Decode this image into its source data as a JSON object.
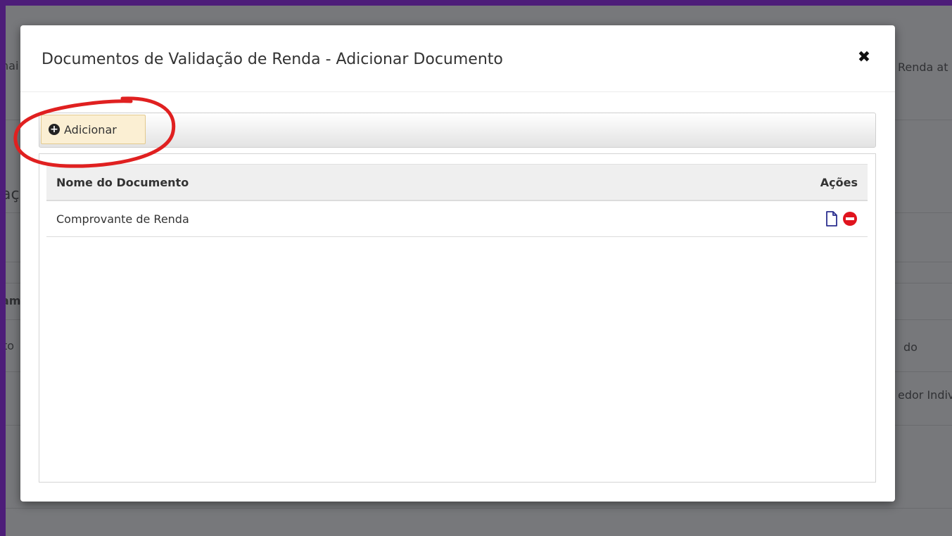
{
  "background": {
    "fragments": [
      "nai",
      "Renda at",
      "aç",
      "am",
      "to",
      "do",
      "edor Indiv"
    ]
  },
  "modal": {
    "title": "Documentos de Validação de Renda - Adicionar Documento",
    "close_symbol": "✖"
  },
  "toolbar": {
    "add_label": "Adicionar"
  },
  "table": {
    "headers": {
      "name": "Nome do Documento",
      "actions": "Ações"
    },
    "rows": [
      {
        "name": "Comprovante de Renda"
      }
    ]
  },
  "icons": {
    "add": "plus-circle-icon",
    "document": "file-outline-icon",
    "remove": "minus-circle-icon",
    "close": "close-icon"
  },
  "colors": {
    "frame": "#4d1d79",
    "overlay": "#77787b",
    "add_button_bg": "#fbefd3",
    "document_icon": "#2b2f8f",
    "remove_icon": "#e0141e",
    "annotation": "#e02020"
  }
}
